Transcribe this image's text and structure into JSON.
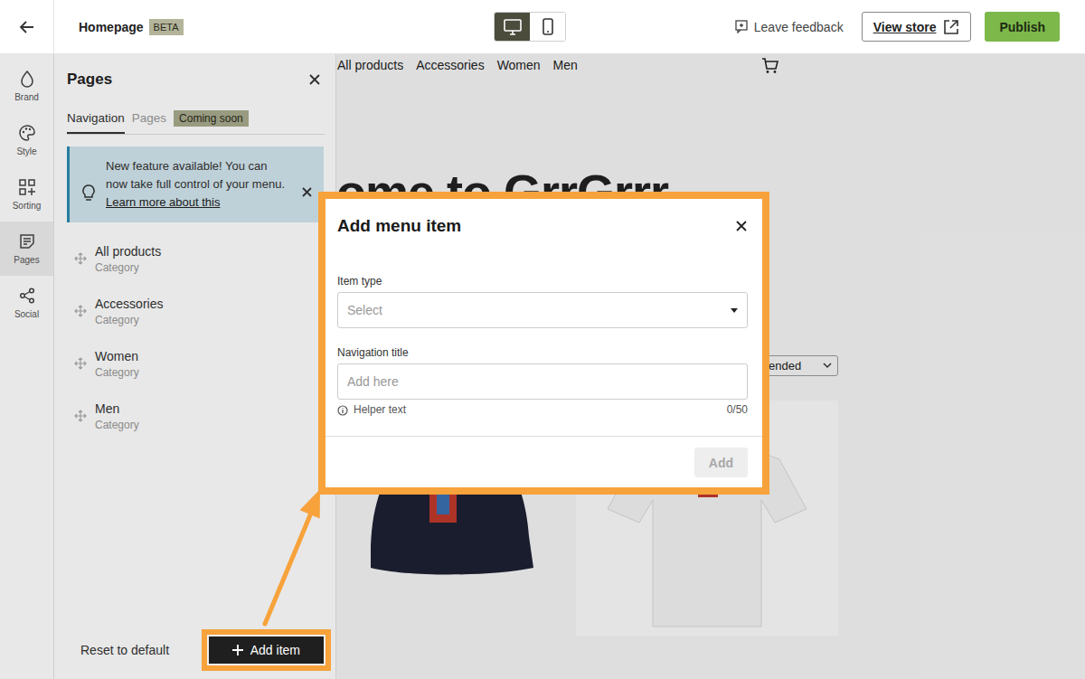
{
  "topbar": {
    "title": "Homepage",
    "badge": "BETA",
    "devices": [
      {
        "kind": "desktop",
        "selected": true
      },
      {
        "kind": "mobile",
        "selected": false
      }
    ],
    "feedback": "Leave feedback",
    "view_store": "View store",
    "publish": "Publish"
  },
  "rail": [
    {
      "label": "Brand",
      "selected": false
    },
    {
      "label": "Style",
      "selected": false
    },
    {
      "label": "Sorting",
      "selected": false
    },
    {
      "label": "Pages",
      "selected": true
    },
    {
      "label": "Social",
      "selected": false
    }
  ],
  "panel": {
    "title": "Pages",
    "tabs": [
      {
        "label": "Navigation",
        "selected": true
      },
      {
        "label": "Pages",
        "selected": false
      }
    ],
    "tab_badge": "Coming soon",
    "banner": {
      "text": "New feature available! You can now take full control of your menu.",
      "link": "Learn more about this"
    },
    "items": [
      {
        "title": "All products",
        "type": "Category"
      },
      {
        "title": "Accessories",
        "type": "Category"
      },
      {
        "title": "Women",
        "type": "Category"
      },
      {
        "title": "Men",
        "type": "Category"
      }
    ],
    "reset": "Reset to default",
    "add_item": "Add item"
  },
  "preview": {
    "nav": [
      "All products",
      "Accessories",
      "Women",
      "Men"
    ],
    "heading": "ome to GrrGrrr",
    "sort": "ended"
  },
  "modal": {
    "title": "Add menu item",
    "item_type": {
      "label": "Item type",
      "placeholder": "Select"
    },
    "nav_title": {
      "label": "Navigation title",
      "placeholder": "Add here",
      "helper": "Helper text",
      "count": "0/50"
    },
    "add": {
      "label": "Add",
      "disabled": true
    }
  }
}
